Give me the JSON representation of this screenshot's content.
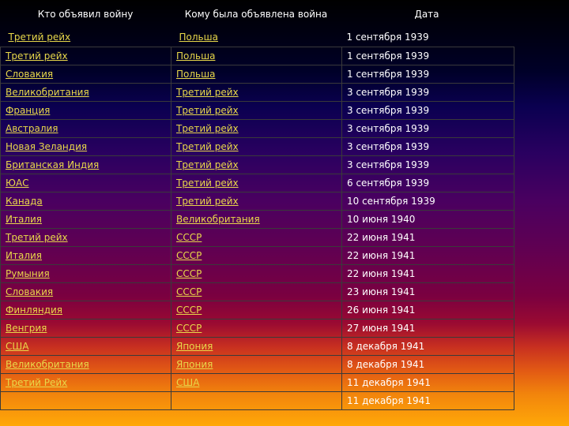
{
  "headers": {
    "declared_by": "Кто объявил войну",
    "declared_on": "Кому была объявлена война",
    "date": "Дата"
  },
  "rows": [
    {
      "by": "Третий рейх",
      "on": "Польша",
      "date": "1 сентября 1939"
    },
    {
      "by": "Третий рейх",
      "on": "Польша",
      "date": "1 сентября 1939"
    },
    {
      "by": "Словакия",
      "on": "Польша",
      "date": "1 сентября 1939"
    },
    {
      "by": "Великобритания",
      "on": "Третий рейх",
      "date": "3 сентября 1939"
    },
    {
      "by": "Франция",
      "on": "Третий рейх",
      "date": "3 сентября 1939"
    },
    {
      "by": "Австралия",
      "on": "Третий рейх",
      "date": "3 сентября 1939"
    },
    {
      "by": "Новая Зеландия",
      "on": "Третий рейх",
      "date": "3 сентября 1939"
    },
    {
      "by": "Британская Индия",
      "on": "Третий рейх",
      "date": "3 сентября 1939"
    },
    {
      "by": "ЮАС",
      "on": "Третий рейх",
      "date": "6 сентября 1939"
    },
    {
      "by": "Канада",
      "on": "Третий рейх",
      "date": "10 сентября 1939"
    },
    {
      "by": "Италия",
      "on": "Великобритания",
      "date": "10 июня 1940"
    },
    {
      "by": "Третий рейх",
      "on": "СССР",
      "date": "22 июня 1941"
    },
    {
      "by": "Италия",
      "on": "СССР",
      "date": "22 июня 1941"
    },
    {
      "by": "Румыния",
      "on": "СССР",
      "date": "22 июня 1941"
    },
    {
      "by": "Словакия",
      "on": "СССР",
      "date": "23 июня 1941"
    },
    {
      "by": "Финляндия",
      "on": "СССР",
      "date": "26 июня 1941"
    },
    {
      "by": "Венгрия",
      "on": "СССР",
      "date": "27 июня 1941"
    },
    {
      "by": "США",
      "on": "Япония",
      "date": "8 декабря 1941"
    },
    {
      "by": "Великобритания",
      "on": "Япония",
      "date": "8 декабря 1941"
    },
    {
      "by": "Третий Рейх",
      "on": "США",
      "date": "11 декабря 1941"
    },
    {
      "by": "",
      "on": "",
      "date": "11 декабря 1941"
    }
  ]
}
